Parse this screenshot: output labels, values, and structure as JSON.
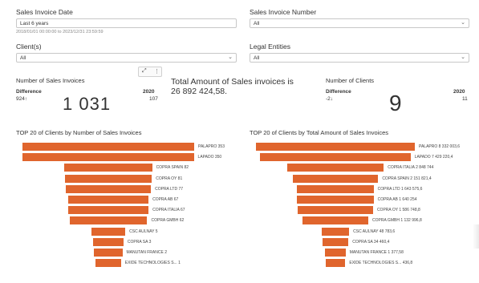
{
  "filters": {
    "sales_invoice_date": {
      "label": "Sales Invoice Date",
      "value": "Last 6 years",
      "range_note": "2018/01/01 00:00:00 to 2023/12/31 23:59:59"
    },
    "sales_invoice_number": {
      "label": "Sales Invoice Number",
      "value": "All"
    },
    "clients": {
      "label": "Client(s)",
      "value": "All"
    },
    "legal_entities": {
      "label": "Legal Entities",
      "value": "All"
    }
  },
  "toolbar": {
    "expand_icon": "expand-icon",
    "more_icon": "more-vertical-icon"
  },
  "kpis": {
    "invoices": {
      "title": "Number of Sales Invoices",
      "diff_label": "Difference",
      "year": "2020",
      "diff_value": "924↑",
      "year_value": "107",
      "big": "1 031"
    },
    "total_amount": {
      "title": "Total Amount of Sales invoices is",
      "value": "26 892 424,58."
    },
    "clients": {
      "title": "Number of Clients",
      "diff_label": "Difference",
      "year": "2020",
      "diff_value": "-2↓",
      "year_value": "11",
      "big": "9"
    }
  },
  "colors": {
    "bar": "#e0652d"
  },
  "chart_data": [
    {
      "type": "bar",
      "title": "TOP 20 of Clients by Number of Sales Invoices",
      "categories": [
        "PALAPRO",
        "LAPADO",
        "COPRA SPAIN",
        "COPRA OY",
        "COPRA LTD",
        "COPRA AB",
        "COPRA ITALIA",
        "COPRA GMBH",
        "CSC AULNAY",
        "COPRA SA",
        "MANUTAN FRANCE",
        "EXIDE TECHNOLOGIES S..."
      ],
      "values": [
        353,
        350,
        82,
        81,
        77,
        67,
        67,
        62,
        5,
        3,
        2,
        1
      ],
      "labels": [
        "PALAPRO 353",
        "LAPADO 350",
        "COPRA SPAIN 82",
        "COPRA OY 81",
        "COPRA LTD 77",
        "COPRA AB 67",
        "COPRA ITALIA 67",
        "COPRA GMBH 62",
        "CSC AULNAY 5",
        "COPRA SA 3",
        "MANUTAN FRANCE 2",
        "EXIDE TECHNOLOGIES S... 1"
      ]
    },
    {
      "type": "bar",
      "title": "TOP 20 of Clients by Total Amount of Sales Invoices",
      "categories": [
        "PALAPRO",
        "LAPADO",
        "COPRA ITALIA",
        "COPRA SPAIN",
        "COPRA LTD",
        "COPRA AB",
        "COPRA OY",
        "COPRA GMBH",
        "CSC AULNAY",
        "COPRA SA",
        "MANUTAN FRANCE",
        "EXIDE TECHNOLOGIES S..."
      ],
      "values": [
        8332003.6,
        7429220.4,
        2848744,
        2151821.4,
        1643575.6,
        1640254,
        1586748.8,
        1132996.8,
        48783.6,
        34460.4,
        1377.58,
        436.8
      ],
      "labels": [
        "PALAPRO 8 332 003,6",
        "LAPADO 7 429 220,4",
        "COPRA ITALIA 2 848 744",
        "COPRA SPAIN 2 151 821,4",
        "COPRA LTD 1 643 575,6",
        "COPRA AB 1 640 254",
        "COPRA OY 1 586 748,8",
        "COPRA GMBH 1 132 996,8",
        "CSC AULNAY 48 783,6",
        "COPRA SA 34 460,4",
        "MANUTAN FRANCE 1 377,58",
        "EXIDE TECHNOLOGIES S... 436,8"
      ]
    }
  ]
}
